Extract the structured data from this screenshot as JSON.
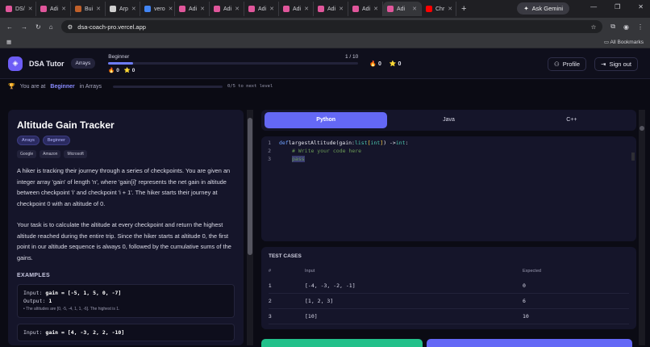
{
  "browser": {
    "tabs": [
      {
        "label": "DS/",
        "color": "#e0569b"
      },
      {
        "label": "Adi",
        "color": "#e0569b"
      },
      {
        "label": "Bui",
        "color": "#c0602a"
      },
      {
        "label": "Arp",
        "color": "#d0d0d0"
      },
      {
        "label": "vero",
        "color": "#4285f4"
      },
      {
        "label": "Adi",
        "color": "#e0569b"
      },
      {
        "label": "Adi",
        "color": "#e0569b"
      },
      {
        "label": "Adi",
        "color": "#e0569b"
      },
      {
        "label": "Adi",
        "color": "#e0569b"
      },
      {
        "label": "Adi",
        "color": "#e0569b"
      },
      {
        "label": "Adi",
        "color": "#e0569b"
      },
      {
        "label": "Adi",
        "color": "#e0569b"
      },
      {
        "label": "Chr",
        "color": "#ff0000"
      }
    ],
    "active_tab_index": 11,
    "gemini_label": "Ask Gemini",
    "url": "dsa-coach-pro.vercel.app",
    "bookmarks_label": "All Bookmarks"
  },
  "header": {
    "brand": "DSA Tutor",
    "topic": "Arrays",
    "level_name": "Beginner",
    "level_progress_text": "1 / 10",
    "level_progress_fraction": 0.1,
    "fire_count": "0",
    "star_count": "0",
    "fire_count2": "0",
    "star_count2": "0",
    "profile": "Profile",
    "signout": "Sign out"
  },
  "levelbar": {
    "prefix": "You are at",
    "level": "Beginner",
    "suffix": "in Arrays",
    "next": "0/5 to next level",
    "progress_fraction": 0
  },
  "problem": {
    "title": "Altitude Gain Tracker",
    "tags": [
      "Arrays",
      "Beginner"
    ],
    "companies": [
      "Google",
      "Amazon",
      "Microsoft"
    ],
    "para1": "A hiker is tracking their journey through a series of checkpoints. You are given an integer array 'gain' of length 'n', where 'gain[i]' represents the net gain in altitude between checkpoint 'i' and checkpoint 'i + 1'. The hiker starts their journey at checkpoint 0 with an altitude of 0.",
    "para2": "Your task is to calculate the altitude at every checkpoint and return the highest altitude reached during the entire trip. Since the hiker starts at altitude 0, the first point in our altitude sequence is always 0, followed by the cumulative sums of the gains.",
    "examples_heading": "EXAMPLES",
    "examples": [
      {
        "input_label": "Input:",
        "input": "gain = [-5, 1, 5, 0, -7]",
        "output_label": "Output:",
        "output": "1",
        "note": "• The altitudes are [0, -5, -4, 1, 1, -6]. The highest is 1."
      },
      {
        "input_label": "Input:",
        "input": "gain = [4, -3, 2, 2, -10]"
      }
    ]
  },
  "editor": {
    "languages": [
      "Python",
      "Java",
      "C++"
    ],
    "active_language": "Python",
    "lines": [
      {
        "n": "1",
        "def": "def",
        "name": " largestAltitude(gain: ",
        "type1": "list",
        "b1": "[",
        "type2": "int",
        "b2": "]",
        "rest": ") -> ",
        "ret": "int",
        "colon": ":"
      },
      {
        "n": "2",
        "comment": "# Write your code here"
      },
      {
        "n": "3",
        "code": "pass"
      }
    ]
  },
  "tests": {
    "heading": "TEST CASES",
    "columns": [
      "#",
      "Input",
      "Expected"
    ],
    "rows": [
      {
        "num": "1",
        "input": "[-4, -3, -2, -1]",
        "expected": "0"
      },
      {
        "num": "2",
        "input": "[1, 2, 3]",
        "expected": "6"
      },
      {
        "num": "3",
        "input": "[10]",
        "expected": "10"
      }
    ]
  },
  "colors": {
    "accent": "#6468f5",
    "run_button": "#22c08a",
    "page_bg": "#0b0b14"
  }
}
